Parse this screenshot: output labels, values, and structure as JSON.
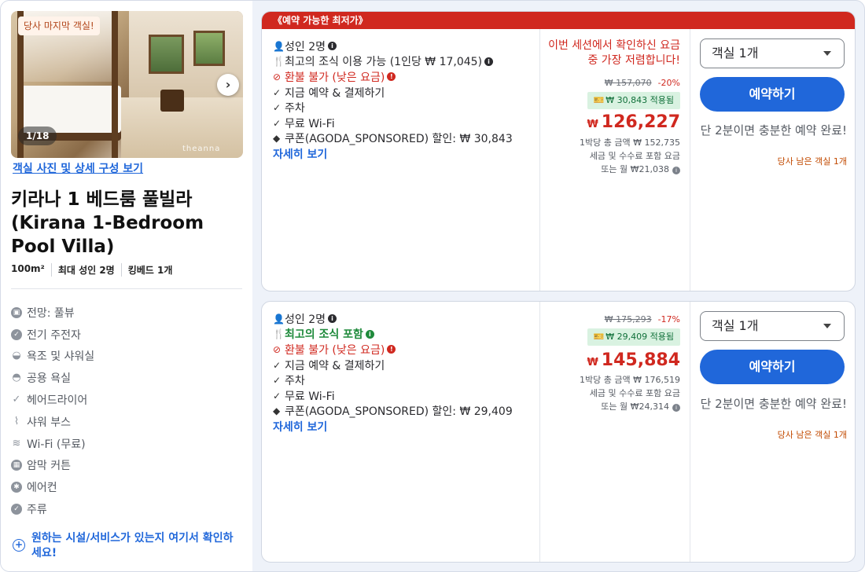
{
  "room": {
    "last_room_badge": "당사 마지막 객실!",
    "photo_count": "1/18",
    "photo_brand": "theanna",
    "photos_link": "객실 사진 및 상세 구성 보기",
    "title": "키라나 1 베드룸 풀빌라 (Kirana 1-Bedroom Pool Villa)",
    "meta": [
      "100m²",
      "최대 성인 2명",
      "킹베드 1개"
    ],
    "amenities": [
      {
        "icon": "image-icon",
        "label": "전망: 풀뷰"
      },
      {
        "icon": "ev-charger-icon",
        "label": "전기 주전자"
      },
      {
        "icon": "bathtub-icon",
        "label": "욕조 및 샤워실"
      },
      {
        "icon": "shared-bath-icon",
        "label": "공용 욕실"
      },
      {
        "icon": "check-icon",
        "label": "헤어드라이어"
      },
      {
        "icon": "shower-icon",
        "label": "샤워 부스"
      },
      {
        "icon": "wifi-icon",
        "label": "Wi-Fi (무료)"
      },
      {
        "icon": "curtain-icon",
        "label": "암막 커튼"
      },
      {
        "icon": "snowflake-icon",
        "label": "에어컨"
      },
      {
        "icon": "check-circle-icon",
        "label": "주류"
      }
    ],
    "request_link": "원하는 시설/서비스가 있는지 여기서 확인하세요!"
  },
  "offers": [
    {
      "banner": "《예약 가능한 최저가》",
      "features": [
        {
          "icon": "person-icon",
          "text": "성인 2명",
          "style": "normal",
          "info": true
        },
        {
          "icon": "cutlery-icon",
          "text": "최고의 조식 이용 가능 (1인당 ₩ 17,045)",
          "style": "normal",
          "info": true
        },
        {
          "icon": "no-icon",
          "text": "환불 불가 (낮은 요금)",
          "style": "red",
          "info": true
        },
        {
          "icon": "check-icon",
          "text": "지금 예약 & 결제하기",
          "style": "normal",
          "info": false
        },
        {
          "icon": "check-icon",
          "text": "주차",
          "style": "normal",
          "info": false
        },
        {
          "icon": "check-icon",
          "text": "무료 Wi-Fi",
          "style": "normal",
          "info": false
        },
        {
          "icon": "tag-icon",
          "text": "쿠폰(AGODA_SPONSORED) 할인: ₩ 30,843",
          "style": "normal",
          "info": false
        }
      ],
      "more_link": "자세히 보기",
      "urgency": "이번 세션에서 확인하신 요금 중 가장 저렴합니다!",
      "original_price": "₩ 157,070",
      "discount_pct": "-20%",
      "coupon_applied": "₩ 30,843 적용됨",
      "currency": "₩",
      "price": "126,227",
      "per_night_total": "1박당 총 금액 ₩ 152,735",
      "tax_note": "세금 및 수수료 포함 요금",
      "monthly": "또는 월 ₩21,038",
      "rooms_select": "객실 1개",
      "book_label": "예약하기",
      "book_note": "단 2분이면 충분한 예약 완료!",
      "rooms_left": "당사 남은 객실 1개"
    },
    {
      "banner": "",
      "features": [
        {
          "icon": "person-icon",
          "text": "성인 2명",
          "style": "normal",
          "info": true
        },
        {
          "icon": "cutlery-icon",
          "text": "최고의 조식 포함",
          "style": "green",
          "info": true
        },
        {
          "icon": "no-icon",
          "text": "환불 불가 (낮은 요금)",
          "style": "red",
          "info": true
        },
        {
          "icon": "check-icon",
          "text": "지금 예약 & 결제하기",
          "style": "normal",
          "info": false
        },
        {
          "icon": "check-icon",
          "text": "주차",
          "style": "normal",
          "info": false
        },
        {
          "icon": "check-icon",
          "text": "무료 Wi-Fi",
          "style": "normal",
          "info": false
        },
        {
          "icon": "tag-icon",
          "text": "쿠폰(AGODA_SPONSORED) 할인: ₩ 29,409",
          "style": "normal",
          "info": false
        }
      ],
      "more_link": "자세히 보기",
      "urgency": "",
      "original_price": "₩ 175,293",
      "discount_pct": "-17%",
      "coupon_applied": "₩ 29,409 적용됨",
      "currency": "₩",
      "price": "145,884",
      "per_night_total": "1박당 총 금액 ₩ 176,519",
      "tax_note": "세금 및 수수료 포함 요금",
      "monthly": "또는 월 ₩24,314",
      "rooms_select": "객실 1개",
      "book_label": "예약하기",
      "book_note": "단 2분이면 충분한 예약 완료!",
      "rooms_left": "당사 남은 객실 1개"
    }
  ],
  "colors": {
    "accent": "#2067da",
    "price_red": "#d0281f",
    "coupon_green": "#d9f2e1"
  }
}
